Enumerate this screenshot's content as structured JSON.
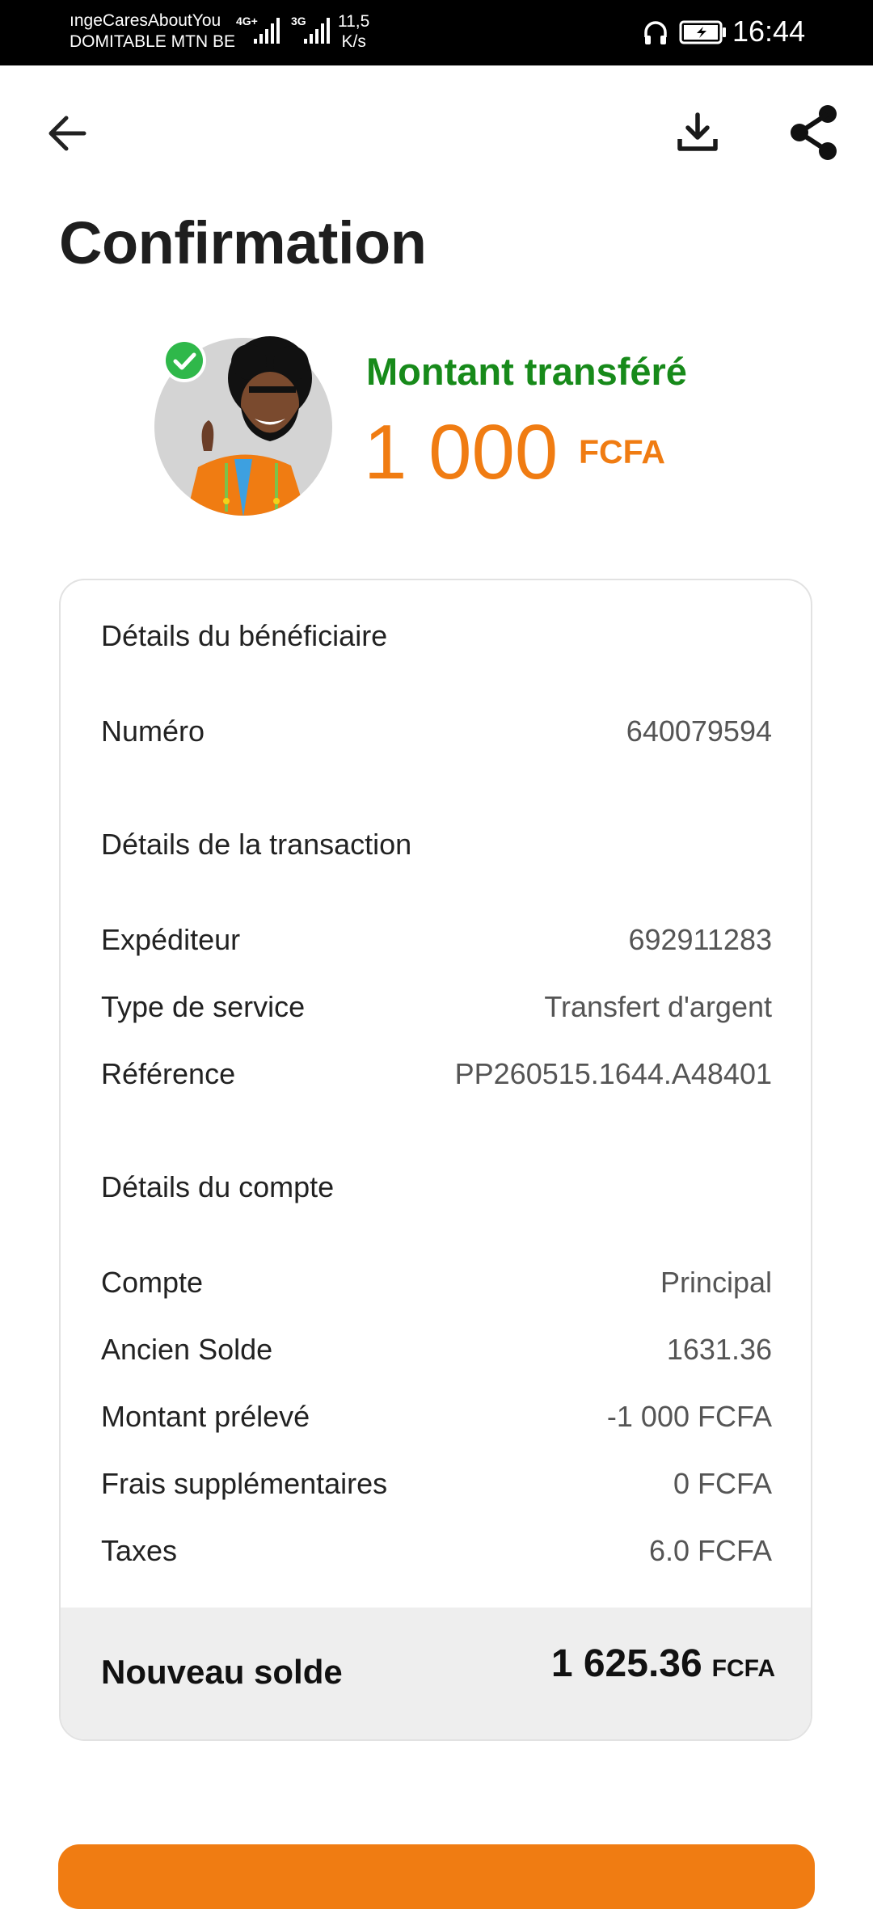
{
  "status_bar": {
    "carrier_line1": "ıngeCaresAboutYou",
    "carrier_line2": "DOMITABLE MTN BE",
    "network1": "4G+",
    "network2": "3G",
    "speed_value": "11,5",
    "speed_unit": "K/s",
    "time": "16:44"
  },
  "app_bar": {
    "back_icon": "arrow-left-icon",
    "download_icon": "download-icon",
    "share_icon": "share-icon"
  },
  "page": {
    "title": "Confirmation"
  },
  "hero": {
    "label": "Montant transféré",
    "amount": "1 000",
    "currency": "FCFA",
    "label_color": "#178a1a",
    "amount_color": "#f07c12"
  },
  "beneficiary": {
    "title": "Détails du bénéficiaire",
    "rows": [
      {
        "label": "Numéro",
        "value": "640079594"
      }
    ]
  },
  "transaction": {
    "title": "Détails de la transaction",
    "rows": [
      {
        "label": "Expéditeur",
        "value": "692911283"
      },
      {
        "label": "Type de service",
        "value": "Transfert d'argent"
      },
      {
        "label": "Référence",
        "value": "PP260515.1644.A48401"
      }
    ]
  },
  "account": {
    "title": "Détails du compte",
    "rows": [
      {
        "label": "Compte",
        "value": "Principal"
      },
      {
        "label": "Ancien Solde",
        "value": "1631.36"
      },
      {
        "label": "Montant prélevé",
        "value": "-1 000 FCFA"
      },
      {
        "label": "Frais supplémentaires",
        "value": "0 FCFA"
      },
      {
        "label": "Taxes",
        "value": "6.0 FCFA"
      }
    ]
  },
  "total": {
    "label": "Nouveau solde",
    "amount": "1 625.36",
    "currency": "FCFA"
  },
  "colors": {
    "accent": "#f07c12",
    "success": "#178a1a"
  }
}
